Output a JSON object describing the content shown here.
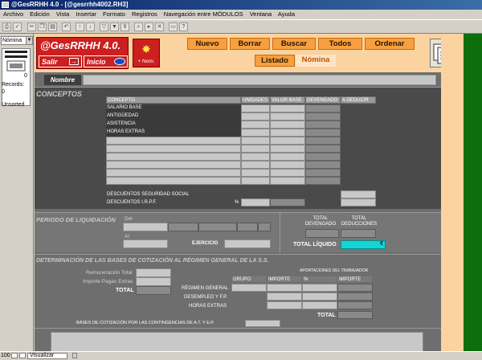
{
  "window": {
    "title": "@GesRRHH 4.0 - [@gesrrhh4002.RH3]"
  },
  "menu": [
    "Archivo",
    "Edición",
    "Vista",
    "Insertar",
    "Formato",
    "Registros",
    "Navegación entre MÓDULOS",
    "Ventana",
    "Ayuda"
  ],
  "left_panel": {
    "selected": "Nómina",
    "zero": "0",
    "records_label": "Records:",
    "records_value": "0",
    "sort": "Unsorted"
  },
  "logo": {
    "title": "@GesRRHH 4.0.",
    "salir": "Salir",
    "inicio": "Inicio"
  },
  "nom_button": "+ Nom.",
  "top_buttons": [
    "Nuevo",
    "Borrar",
    "Buscar",
    "Todos",
    "Ordenar"
  ],
  "tabs": {
    "listado": "Listado",
    "nomina": "Nómina"
  },
  "nombre_label": "Nombre",
  "conceptos": {
    "title": "CONCEPTOS",
    "headers": [
      "CONCEPTO",
      "UNIDADES",
      "VALOR BASE",
      "DEVENGADO",
      "A DEDUCIR"
    ],
    "rows": [
      "SALARIO BASE",
      "ANTIGÜEDAD",
      "ASISTENCIA",
      "HORAS EXTRAS"
    ],
    "desc_ss": "DESCUENTOS SEGURIDAD SOCIAL",
    "desc_irpf": "DESCUENTOS I.R.P.F.",
    "percent": "%"
  },
  "periodo": {
    "title": "PERIODO DE LIQUIDACIÓN",
    "del": "Del",
    "al": "Al",
    "ejercicio": "EJERCICIO",
    "total_devengado": "TOTAL DEVENGADO",
    "total_deducciones": "TOTAL DEDUCCIONES",
    "total_liquido": "TOTAL LÍQUIDO",
    "currency": "€"
  },
  "bases": {
    "title": "DETERMINACIÓN DE LAS BASES DE COTIZACIÓN AL RÉGIMEN GENERAL DE LA S.S.",
    "rem_total": "Remuneración Total",
    "importe_pagas": "Importe Pagas Extras",
    "total": "TOTAL",
    "aport_header": "APORTACIONES DEL TRABAJADOR",
    "grupo": "GRUPO",
    "importe": "IMPORTE",
    "pct": "%",
    "importe2": "IMPORTE",
    "regimen": "RÉGIMEN GENERAL",
    "desempleo": "DESEMPLEO Y F.P.",
    "horas": "HORAS EXTRAS",
    "total2": "TOTAL",
    "contingencias": "BASES DE COTIZACIÓN POR LAS CONTINGENCIAS DE A.T. Y E.P."
  },
  "status": {
    "zoom": "100",
    "view": "Visualizar"
  }
}
